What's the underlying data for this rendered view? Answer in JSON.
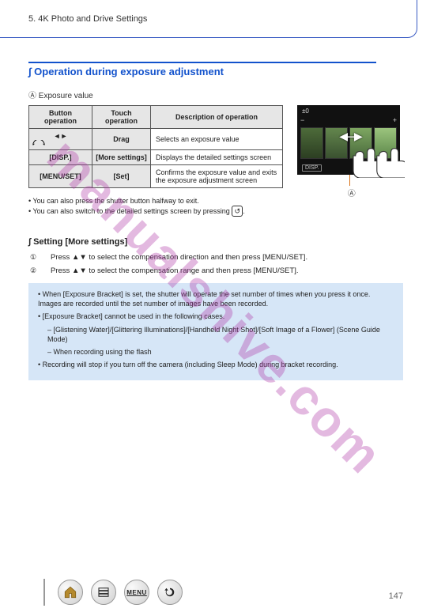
{
  "header": {
    "breadcrumb": "5. 4K Photo and Drive Settings"
  },
  "section": {
    "rule_title": "∫ Operation during exposure adjustment",
    "a_label": "A Exposure value"
  },
  "table": {
    "headers": [
      "Button operation",
      "Touch operation",
      "Description of operation"
    ],
    "rows": [
      {
        "button_glyph": "◄►",
        "button_glyph2": "dial",
        "touch": "Drag",
        "desc": "Selects an exposure value"
      },
      {
        "button": "[DISP.]",
        "touch": "[More settings]",
        "desc": "Displays the detailed settings screen"
      },
      {
        "button": "[MENU/SET]",
        "touch": "[Set]",
        "desc": "Confirms the exposure value and exits the exposure adjustment screen"
      }
    ]
  },
  "camera": {
    "topbar": "±0",
    "minus": "−",
    "plus": "+",
    "disp": "DISP.",
    "arrow": "◄─►",
    "marker_a": "A"
  },
  "after_table": {
    "line1": "You can also press the shutter button halfway to exit.",
    "line2_pre": "You can also switch to the detailed settings screen by pressing ",
    "line2_icon": "↺",
    "line2_post": "."
  },
  "detailed": {
    "heading": "∫ Setting [More settings]",
    "step1_pre": "Press ",
    "step1_glyph": "▲▼",
    "step1_post": " to select the compensation direction and then press [MENU/SET].",
    "step2_pre": "Press ",
    "step2_glyph": "▲▼",
    "step2_post": " to select the compensation range and then press [MENU/SET]."
  },
  "notes": {
    "n1": "When [Exposure Bracket] is set, the shutter will operate the set number of times when you press it once. Images are recorded until the set number of images have been recorded.",
    "n2": "[Exposure Bracket] cannot be used in the following cases.",
    "n2a": "– [Glistening Water]/[Glittering Illuminations]/[Handheld Night Shot]/[Soft Image of a Flower] (Scene Guide Mode)",
    "n2b": "– When recording using the flash",
    "n3": "Recording will stop if you turn off the camera (including Sleep Mode) during bracket recording."
  },
  "nav": {
    "home_icon": "home",
    "layers_icon": "layers",
    "menu_label": "MENU",
    "back_icon": "back"
  },
  "page_num": "147"
}
